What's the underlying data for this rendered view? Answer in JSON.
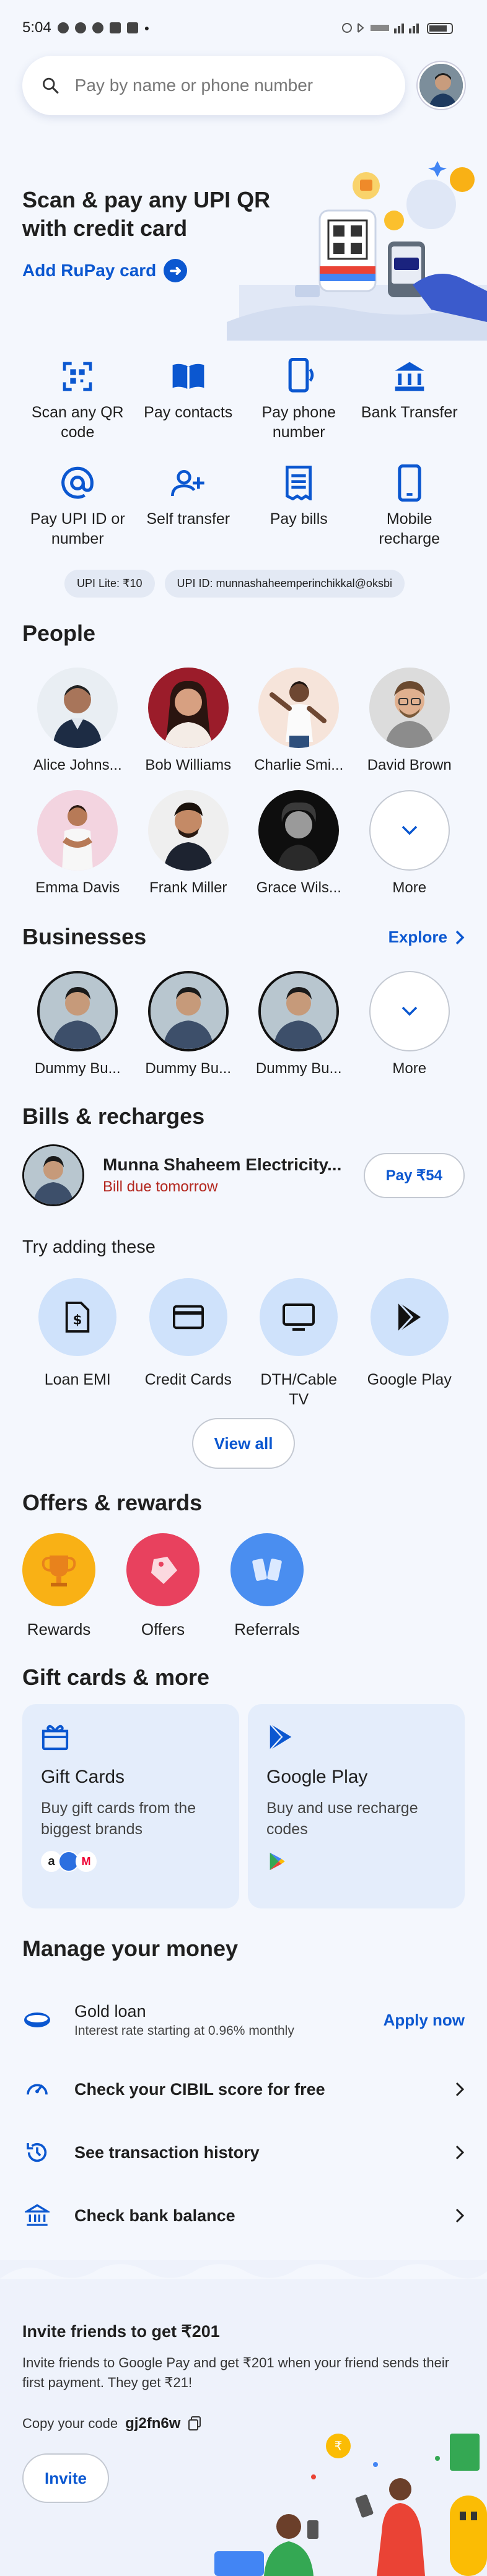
{
  "status_bar": {
    "time": "5:04"
  },
  "search": {
    "placeholder": "Pay by name or phone number"
  },
  "hero": {
    "title": "Scan & pay any UPI QR with credit card",
    "link": "Add RuPay card"
  },
  "quick_actions": [
    {
      "label": "Scan any QR code",
      "icon": "qr-scan-icon"
    },
    {
      "label": "Pay contacts",
      "icon": "contacts-book-icon"
    },
    {
      "label": "Pay phone number",
      "icon": "phone-icon"
    },
    {
      "label": "Bank Transfer",
      "icon": "bank-icon"
    },
    {
      "label": "Pay UPI ID or number",
      "icon": "at-sign-icon"
    },
    {
      "label": "Self transfer",
      "icon": "self-transfer-icon"
    },
    {
      "label": "Pay bills",
      "icon": "bill-icon"
    },
    {
      "label": "Mobile recharge",
      "icon": "mobile-icon"
    }
  ],
  "pills": {
    "upi_lite": "UPI Lite: ₹10",
    "upi_id": "UPI ID: munnashaheemperinchikkal@oksbi"
  },
  "people": {
    "title": "People",
    "items": [
      {
        "name": "Alice Johns..."
      },
      {
        "name": "Bob Williams"
      },
      {
        "name": "Charlie Smi..."
      },
      {
        "name": "David Brown"
      },
      {
        "name": "Emma Davis"
      },
      {
        "name": "Frank Miller"
      },
      {
        "name": "Grace Wils..."
      }
    ],
    "more": "More"
  },
  "businesses": {
    "title": "Businesses",
    "explore": "Explore",
    "items": [
      {
        "name": "Dummy Bu..."
      },
      {
        "name": "Dummy Bu..."
      },
      {
        "name": "Dummy Bu..."
      }
    ],
    "more": "More"
  },
  "bills": {
    "title": "Bills & recharges",
    "name": "Munna Shaheem Electricity...",
    "due": "Bill due tomorrow",
    "pay": "Pay ₹54"
  },
  "try_adding": {
    "title": "Try adding these",
    "items": [
      {
        "label": "Loan EMI",
        "icon": "loan-emi-icon"
      },
      {
        "label": "Credit Cards",
        "icon": "credit-card-icon"
      },
      {
        "label": "DTH/Cable TV",
        "icon": "tv-icon"
      },
      {
        "label": "Google Play",
        "icon": "google-play-icon"
      }
    ],
    "view_all": "View all"
  },
  "offers": {
    "title": "Offers & rewards",
    "items": [
      {
        "label": "Rewards",
        "icon": "trophy-icon",
        "color": "#f9b115"
      },
      {
        "label": "Offers",
        "icon": "tag-icon",
        "color": "#e8415e"
      },
      {
        "label": "Referrals",
        "icon": "referral-phones-icon",
        "color": "#4a8ef0"
      }
    ]
  },
  "gift_cards": {
    "title": "Gift cards & more",
    "cards": [
      {
        "title": "Gift Cards",
        "desc": "Buy gift cards from the biggest brands"
      },
      {
        "title": "Google Play",
        "desc": "Buy and use recharge codes"
      }
    ]
  },
  "manage_money": {
    "title": "Manage your money",
    "gold_loan": {
      "title": "Gold loan",
      "sub": "Interest rate starting at 0.96% monthly",
      "action": "Apply now"
    },
    "rows": [
      {
        "label": "Check your CIBIL score for free",
        "icon": "speedometer-icon"
      },
      {
        "label": "See transaction history",
        "icon": "history-icon"
      },
      {
        "label": "Check bank balance",
        "icon": "bank-icon"
      }
    ]
  },
  "invite": {
    "title": "Invite friends to get ₹201",
    "desc": "Invite friends to Google Pay and get ₹201 when your friend sends their first payment. They get ₹21!",
    "code_label": "Copy your code",
    "code": "gj2fn6w",
    "button": "Invite"
  }
}
